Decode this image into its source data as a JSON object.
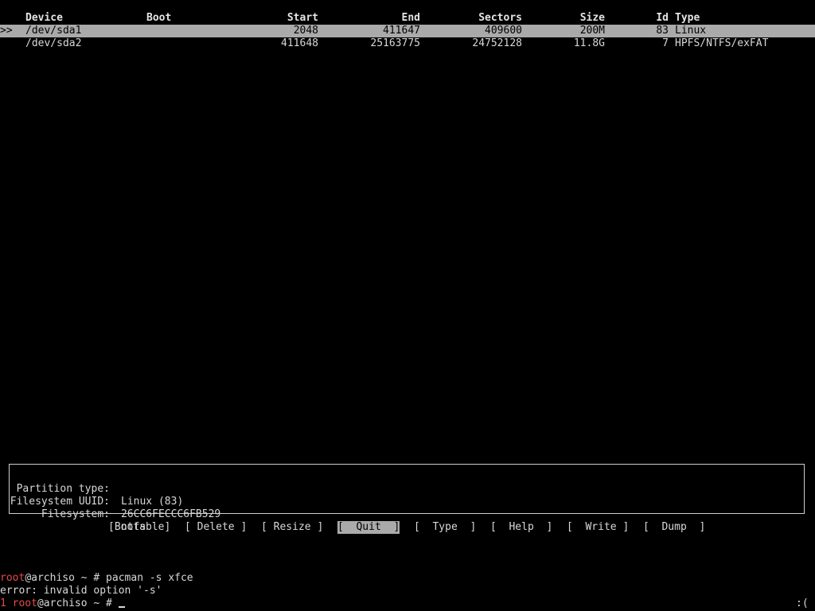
{
  "table": {
    "headers": {
      "device": "Device",
      "boot": "Boot",
      "start": "Start",
      "end": "End",
      "sectors": "Sectors",
      "size": "Size",
      "id": "Id",
      "type": "Type"
    },
    "selection_marker": ">>",
    "rows": [
      {
        "device": "/dev/sda1",
        "boot": "",
        "start": "2048",
        "end": "411647",
        "sectors": "409600",
        "size": "200M",
        "id": "83",
        "type": "Linux",
        "selected": true
      },
      {
        "device": "/dev/sda2",
        "boot": "",
        "start": "411648",
        "end": "25163775",
        "sectors": "24752128",
        "size": "11.8G",
        "id": "7",
        "type": "HPFS/NTFS/exFAT",
        "selected": false
      }
    ]
  },
  "info": {
    "partition_type_label": "Partition type:",
    "partition_type_value": "Linux (83)",
    "uuid_label": "Filesystem UUID:",
    "uuid_value": "26CC6FECCC6FB529",
    "filesystem_label": "Filesystem:",
    "filesystem_value": "ntfs"
  },
  "menu": {
    "bootable": "[Bootable]",
    "delete": "[ Delete ]",
    "resize": "[ Resize ]",
    "quit": "[  Quit  ]",
    "type": "[  Type  ]",
    "help": "[  Help  ]",
    "write": "[  Write ]",
    "dump": "[  Dump  ]",
    "active": "quit"
  },
  "terminal": {
    "line1_user": "root",
    "line1_rest": "@archiso ~ # pacman -s xfce",
    "line2": "error: invalid option '-s'",
    "line3_status": "1",
    "line3_user": "root",
    "line3_rest": "@archiso ~ # ",
    "right_status": ":("
  },
  "colors": {
    "background": "#000000",
    "foreground": "#d8d8d8",
    "highlight": "#aaaaaa",
    "prompt_red": "#e44a4a"
  }
}
